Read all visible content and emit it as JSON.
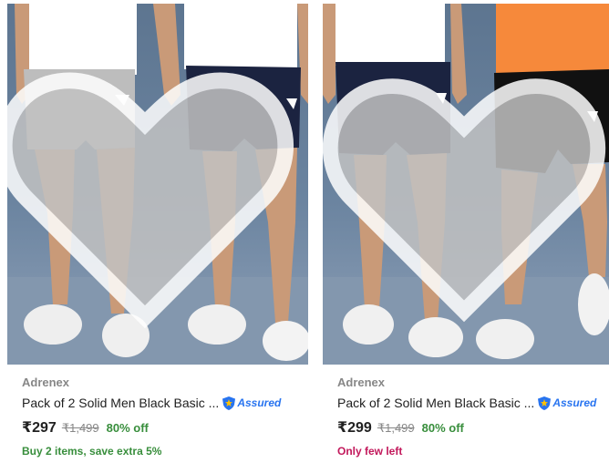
{
  "colors": {
    "assured_blue": "#2874f0",
    "discount_green": "#388e3c",
    "stock_pink": "#c2185b"
  },
  "products": [
    {
      "brand": "Adrenex",
      "title": "Pack of 2 Solid Men Black Basic ...",
      "assured_label": "Assured",
      "price": "₹297",
      "mrp": "₹1,499",
      "discount": "80% off",
      "offer": "Buy 2 items, save extra 5%",
      "wishlist_icon": "heart-icon",
      "image_description_shorts": [
        "light-grey",
        "navy"
      ]
    },
    {
      "brand": "Adrenex",
      "title": "Pack of 2 Solid Men Black Basic ...",
      "assured_label": "Assured",
      "price": "₹299",
      "mrp": "₹1,499",
      "discount": "80% off",
      "offer": "Only few left",
      "wishlist_icon": "heart-icon",
      "image_description_shorts": [
        "navy",
        "black"
      ]
    }
  ]
}
